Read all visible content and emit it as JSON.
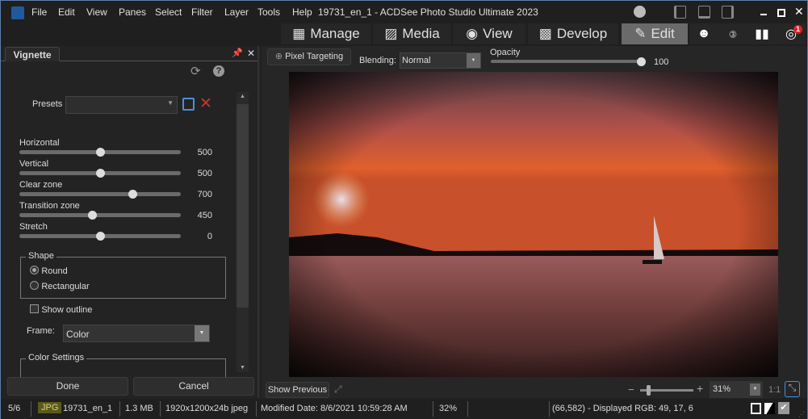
{
  "titlebar": {
    "title": "19731_en_1 - ACDSee Photo Studio Ultimate 2023",
    "menu": [
      "File",
      "Edit",
      "View",
      "Panes",
      "Select",
      "Filter",
      "Layer",
      "Tools",
      "Help"
    ]
  },
  "modes": {
    "manage": "Manage",
    "media": "Media",
    "view": "View",
    "develop": "Develop",
    "edit": "Edit",
    "active": "Edit",
    "notification_badge": "1"
  },
  "panel": {
    "tab": "Vignette",
    "presets_label": "Presets",
    "presets_value": "",
    "sliders": [
      {
        "label": "Horizontal",
        "value": "500",
        "fraction": 0.5
      },
      {
        "label": "Vertical",
        "value": "500",
        "fraction": 0.5
      },
      {
        "label": "Clear zone",
        "value": "700",
        "fraction": 0.7
      },
      {
        "label": "Transition zone",
        "value": "450",
        "fraction": 0.45
      },
      {
        "label": "Stretch",
        "value": "0",
        "fraction": 0.5
      }
    ],
    "shape": {
      "label": "Shape",
      "options": [
        "Round",
        "Rectangular"
      ],
      "selected": "Round"
    },
    "show_outline": "Show outline",
    "show_outline_checked": false,
    "frame_label": "Frame:",
    "frame_value": "Color",
    "color_settings": "Color Settings",
    "done": "Done",
    "cancel": "Cancel"
  },
  "toolbar": {
    "pixel_targeting": "Pixel Targeting",
    "blending_label": "Blending:",
    "blending_value": "Normal",
    "opacity_label": "Opacity",
    "opacity_value": "100",
    "opacity_fraction": 1.0
  },
  "bottom": {
    "show_previous": "Show Previous",
    "zoom": "31%",
    "one_to_one": "1:1"
  },
  "status": {
    "index": "5/6",
    "format": "JPG",
    "filename": "19731_en_1",
    "size": "1.3 MB",
    "dims": "1920x1200x24b jpeg",
    "modified": "Modified Date: 8/6/2021 10:59:28 AM",
    "zoom": "32%",
    "pixel": "(66,582) - Displayed RGB: 49, 17, 6"
  },
  "colors": {
    "accent": "#4a90d9",
    "active_mode": "#6a6a6a",
    "delete": "#c0392b",
    "badge": "#e02020"
  }
}
